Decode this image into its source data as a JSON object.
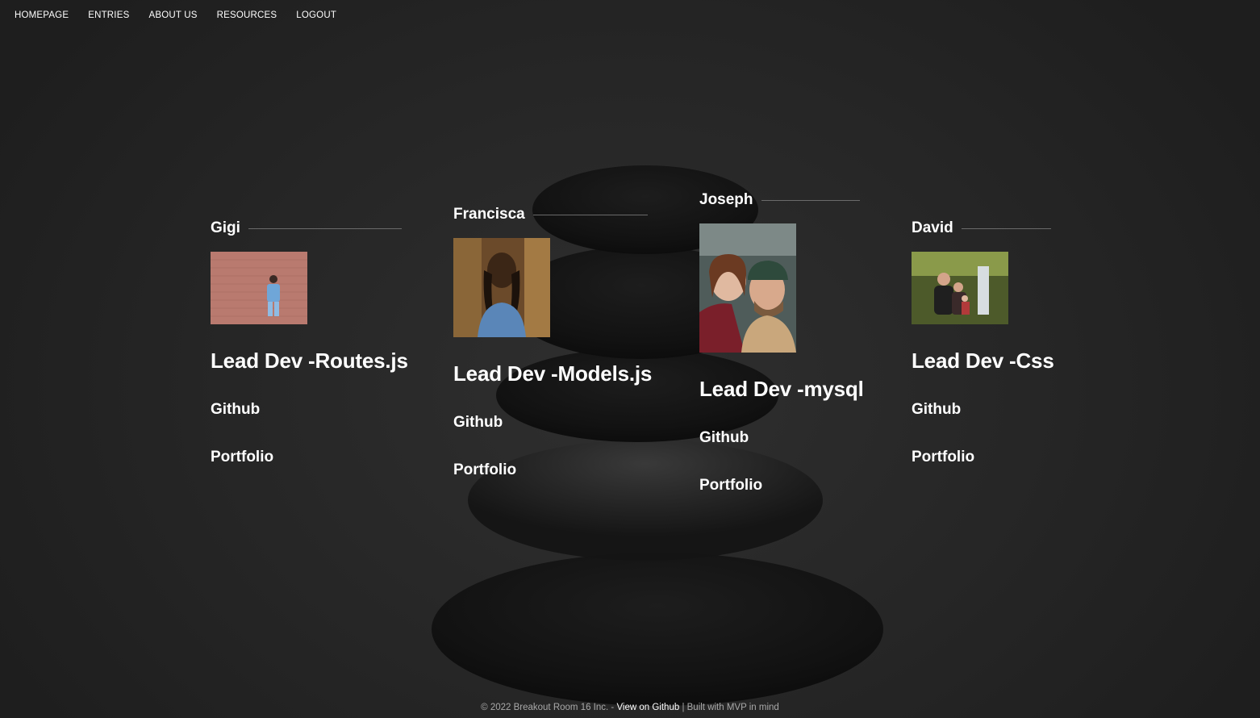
{
  "nav": {
    "items": [
      {
        "label": "HOMEPAGE"
      },
      {
        "label": "ENTRIES"
      },
      {
        "label": "ABOUT US"
      },
      {
        "label": "RESOURCES"
      },
      {
        "label": "LOGOUT"
      }
    ]
  },
  "members": [
    {
      "name": "Gigi",
      "role": "Lead Dev -Routes.js",
      "github": "Github",
      "portfolio": "Portfolio"
    },
    {
      "name": "Francisca",
      "role": "Lead Dev -Models.js",
      "github": "Github",
      "portfolio": "Portfolio"
    },
    {
      "name": "Joseph",
      "role": "Lead Dev -mysql",
      "github": "Github",
      "portfolio": "Portfolio"
    },
    {
      "name": "David",
      "role": "Lead Dev -Css",
      "github": "Github",
      "portfolio": "Portfolio"
    }
  ],
  "footer": {
    "copyright": "© 2022 Breakout Room 16 Inc. - ",
    "github_link": "View on Github",
    "built_with": " | Built with MVP in mind"
  },
  "colors": {
    "background": "#262626",
    "text": "#ffffff",
    "footer_text": "#a9a9a9",
    "rule": "#6a6a6a"
  }
}
